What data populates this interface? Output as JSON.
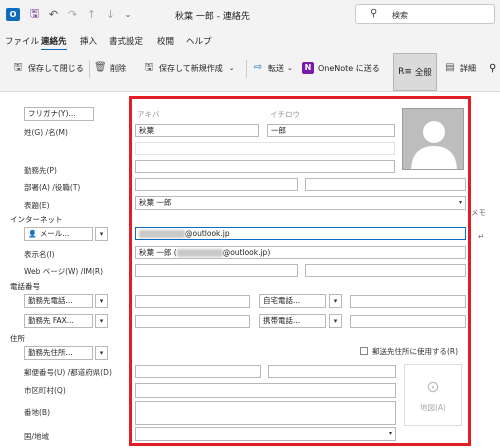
{
  "titlebar": {
    "title": "秋葉 一郎 - 連絡先",
    "search_placeholder": "検索",
    "icons": [
      "outlook-logo-icon",
      "save-icon",
      "undo-icon",
      "redo-icon",
      "up-arrow-icon",
      "down-arrow-icon",
      "dropdown-icon"
    ]
  },
  "menu": [
    "ファイル",
    "連絡先",
    "挿入",
    "書式設定",
    "校閲",
    "ヘルプ"
  ],
  "ribbon": {
    "save_close": "保存して閉じる",
    "delete": "削除",
    "save_new": "保存して新規作成",
    "forward": "転送",
    "onenote": "OneNote に送る",
    "all_fields": "全般",
    "details": "詳細"
  },
  "form": {
    "furigana_btn": "フリガナ(Y)...",
    "furigana_last_ph": "アキバ",
    "furigana_first_ph": "イチロウ",
    "name_label": "姓(G) /名(M)",
    "last_name": "秋葉",
    "first_name": "一郎",
    "company_label": "勤務先(P)",
    "dept_label": "部署(A) /役職(T)",
    "display_as_label": "表題(E)",
    "display_as_value": "秋葉 一郎",
    "internet_label": "インターネット",
    "email_select": "メール...",
    "email_domain": "@outlook.jp",
    "display_name_label": "表示名(I)",
    "display_name_prefix": "秋葉 一郎 (",
    "display_name_suffix": "@outlook.jp)",
    "web_label": "Web ページ(W) /IM(R)",
    "phone_label": "電話番号",
    "phone1_select": "勤務先電話...",
    "phone2_select": "勤務先 FAX...",
    "phone3_select": "自宅電話...",
    "phone4_select": "携帯電話...",
    "address_label": "住所",
    "address_select": "勤務先住所...",
    "mailing_checkbox": "郵送先住所に使用する(R)",
    "postal_label": "郵便番号(U) /都道府県(D)",
    "city_label": "市区町村(Q)",
    "street_label": "番地(B)",
    "country_label": "国/地域",
    "map_button": "地図(A)",
    "memo_label": "メモ"
  },
  "colors": {
    "accent": "#0f6cbd",
    "highlight_frame": "#e21d24"
  }
}
